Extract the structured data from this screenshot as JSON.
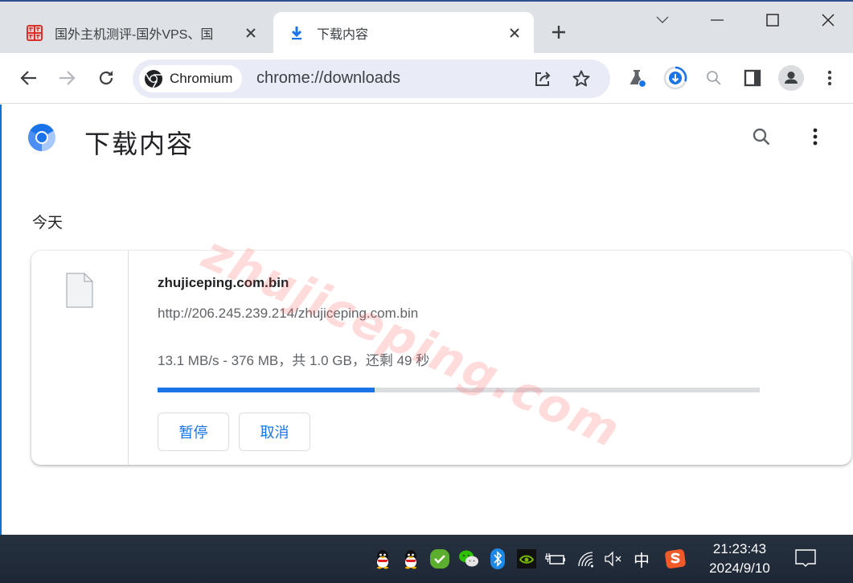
{
  "browser": {
    "tabs": [
      {
        "title": "国外主机测评-国外VPS、国",
        "active": false,
        "favicon": "site-seal-icon"
      },
      {
        "title": "下载内容",
        "active": true,
        "favicon": "download-icon"
      }
    ],
    "new_tab_label": "+",
    "window_controls": [
      "tab-search",
      "minimize",
      "maximize",
      "close"
    ],
    "omnibox": {
      "chip_label": "Chromium",
      "url": "chrome://downloads"
    },
    "accent_color": "#1a73e8"
  },
  "page": {
    "title": "下载内容",
    "section_label": "今天",
    "watermark": "zhujiceping.com",
    "downloads": [
      {
        "file_name": "zhujiceping.com.bin",
        "url": "http://206.245.239.214/zhujiceping.com.bin",
        "status": "13.1 MB/s - 376 MB，共 1.0 GB，还剩 49 秒",
        "progress": 0.36,
        "actions": {
          "pause": "暂停",
          "cancel": "取消"
        }
      }
    ]
  },
  "taskbar": {
    "tray_icons": [
      "qq-icon",
      "qq-icon",
      "security-check-icon",
      "wechat-icon",
      "bluetooth-icon",
      "nvidia-icon",
      "battery-charging-icon",
      "wifi-icon",
      "volume-muted-icon",
      "ime-chinese-icon",
      "sogou-input-icon"
    ],
    "ime_label": "中",
    "time": "21:23:43",
    "date": "2024/9/10"
  }
}
